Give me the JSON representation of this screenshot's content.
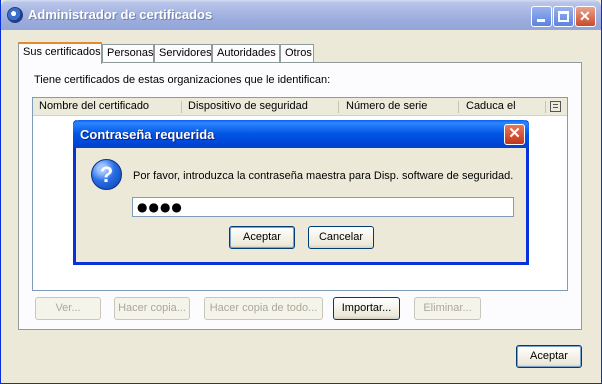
{
  "window": {
    "title": "Administrador de certificados"
  },
  "tabs": [
    {
      "label": "Sus certificados",
      "active": true
    },
    {
      "label": "Personas"
    },
    {
      "label": "Servidores"
    },
    {
      "label": "Autoridades"
    },
    {
      "label": "Otros"
    }
  ],
  "panel": {
    "description": "Tiene certificados de estas organizaciones que le identifican:",
    "columns": [
      "Nombre del certificado",
      "Dispositivo de seguridad",
      "Número de serie",
      "Caduca el"
    ]
  },
  "actions": {
    "ver": "Ver...",
    "backup": "Hacer copia...",
    "backup_all": "Hacer copia de todo...",
    "import": "Importar...",
    "delete": "Eliminar..."
  },
  "footer": {
    "ok": "Aceptar"
  },
  "modal": {
    "title": "Contraseña requerida",
    "message": "Por favor, introduzca la contraseña maestra para Disp. software de seguridad.",
    "password_value": "●●●●",
    "ok": "Aceptar",
    "cancel": "Cancelar"
  }
}
